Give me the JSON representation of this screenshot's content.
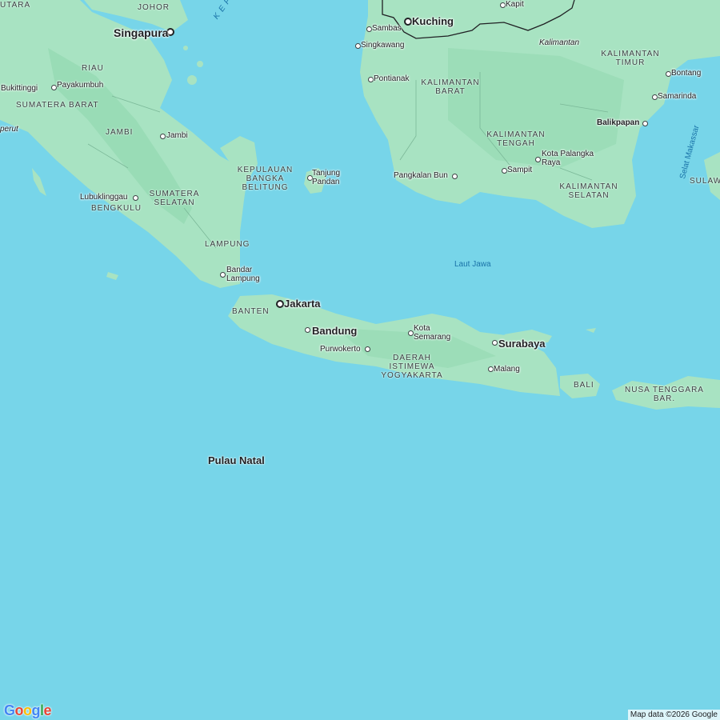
{
  "colors": {
    "water": "#77d5e9",
    "land": "#a8e3c2",
    "land_dark": "#8fd7ae",
    "border": "#202124"
  },
  "logo": {
    "letters": [
      "G",
      "o",
      "o",
      "g",
      "l",
      "e"
    ],
    "colors": [
      "#4285f4",
      "#ea4335",
      "#fbbc05",
      "#4285f4",
      "#34a853",
      "#ea4335"
    ]
  },
  "attribution": "Map data ©2026 Google",
  "labels": {
    "jambi_partial": "JAMBI",
    "ntara": "UTARA",
    "johor": "JOHOR",
    "singapura": "Singapura",
    "kepulauan": "K E P U",
    "riau": "RIAU",
    "bukittinggi": "Bukittinggi",
    "payakumbuh": "Payakumbuh",
    "sumatera_barat": "SUMATERA BARAT",
    "perut": "perut",
    "jambi_city": "Jambi",
    "kep_babel": "KEPULAUAN BANGKA BELITUNG",
    "tanjung_pandan": "Tanjung Pandan",
    "lubuklinggau": "Lubuklinggau",
    "sumatera_selatan": "SUMATERA SELATAN",
    "bengkulu": "BENGKULU",
    "lampung": "LAMPUNG",
    "bandar_lampung": "Bandar Lampung",
    "kuching": "Kuching",
    "kapit": "Kapit",
    "sambas": "Sambas",
    "singkawang": "Singkawang",
    "kalimantan": "Kalimantan",
    "pontianak": "Pontianak",
    "kalbar": "KALIMANTAN BARAT",
    "kaltim": "KALIMANTAN TIMUR",
    "bontang": "Bontang",
    "samarinda": "Samarinda",
    "balikpapan": "Balikpapan",
    "selat_makassar": "Selat Makassar",
    "sulaw": "SULAW",
    "kalteng": "KALIMANTAN TENGAH",
    "palangka": "Kota Palangka Raya",
    "sampit": "Sampit",
    "pangkalan_bun": "Pangkalan Bun",
    "kalsel": "KALIMANTAN SELATAN",
    "laut_jawa": "Laut Jawa",
    "jakarta": "Jakarta",
    "banten": "BANTEN",
    "bandung": "Bandung",
    "purwokerto": "Purwokerto",
    "semarang": "Kota Semarang",
    "diy": "DAERAH ISTIMEWA YOGYAKARTA",
    "surabaya": "Surabaya",
    "malang": "Malang",
    "bali": "BALI",
    "ntb": "NUSA TENGGARA BAR.",
    "pulau_natal": "Pulau Natal"
  }
}
